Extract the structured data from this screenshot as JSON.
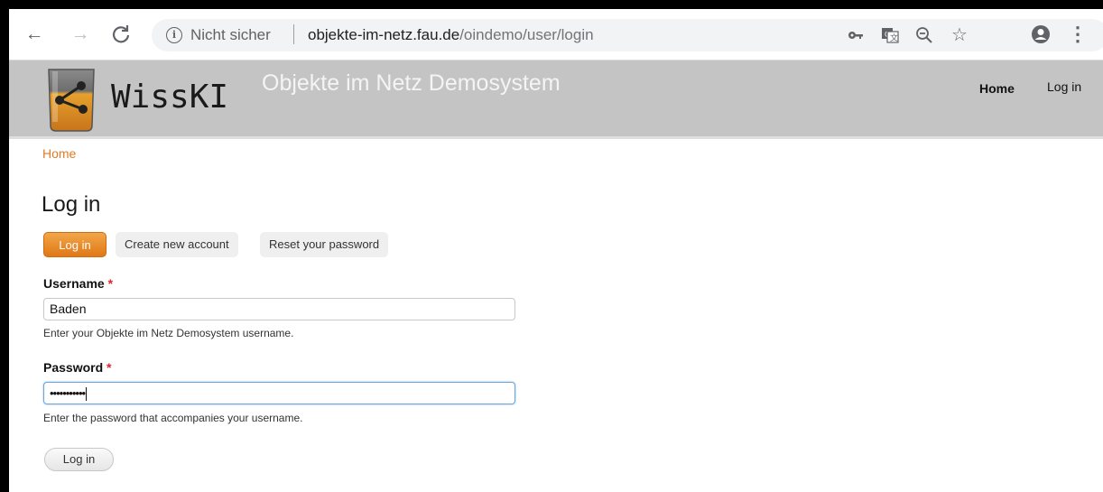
{
  "browser": {
    "security_label": "Nicht sicher",
    "url_domain": "objekte-im-netz.fau.de",
    "url_path": "/oindemo/user/login",
    "icons": [
      "back-icon",
      "forward-icon",
      "reload-icon",
      "info-icon",
      "key-icon",
      "translate-icon",
      "zoom-out-icon",
      "star-icon",
      "account-icon",
      "menu-icon"
    ]
  },
  "site": {
    "logo_text": "WissKI",
    "name": "Objekte im Netz Demosystem",
    "nav": {
      "home": "Home",
      "login": "Log in"
    },
    "colors": {
      "header_bg": "#c4c4c4",
      "accent": "#e07b23"
    }
  },
  "breadcrumb": "Home",
  "page_title": "Log in",
  "tabs": [
    {
      "label": "Log in",
      "active": true
    },
    {
      "label": "Create new account",
      "active": false
    },
    {
      "label": "Reset your password",
      "active": false
    }
  ],
  "form": {
    "username": {
      "label": "Username",
      "required_marker": "*",
      "value": "Baden",
      "description": "Enter your Objekte im Netz Demosystem username."
    },
    "password": {
      "label": "Password",
      "required_marker": "*",
      "value": "•••••••••••",
      "description": "Enter the password that accompanies your username."
    },
    "submit_label": "Log in"
  }
}
